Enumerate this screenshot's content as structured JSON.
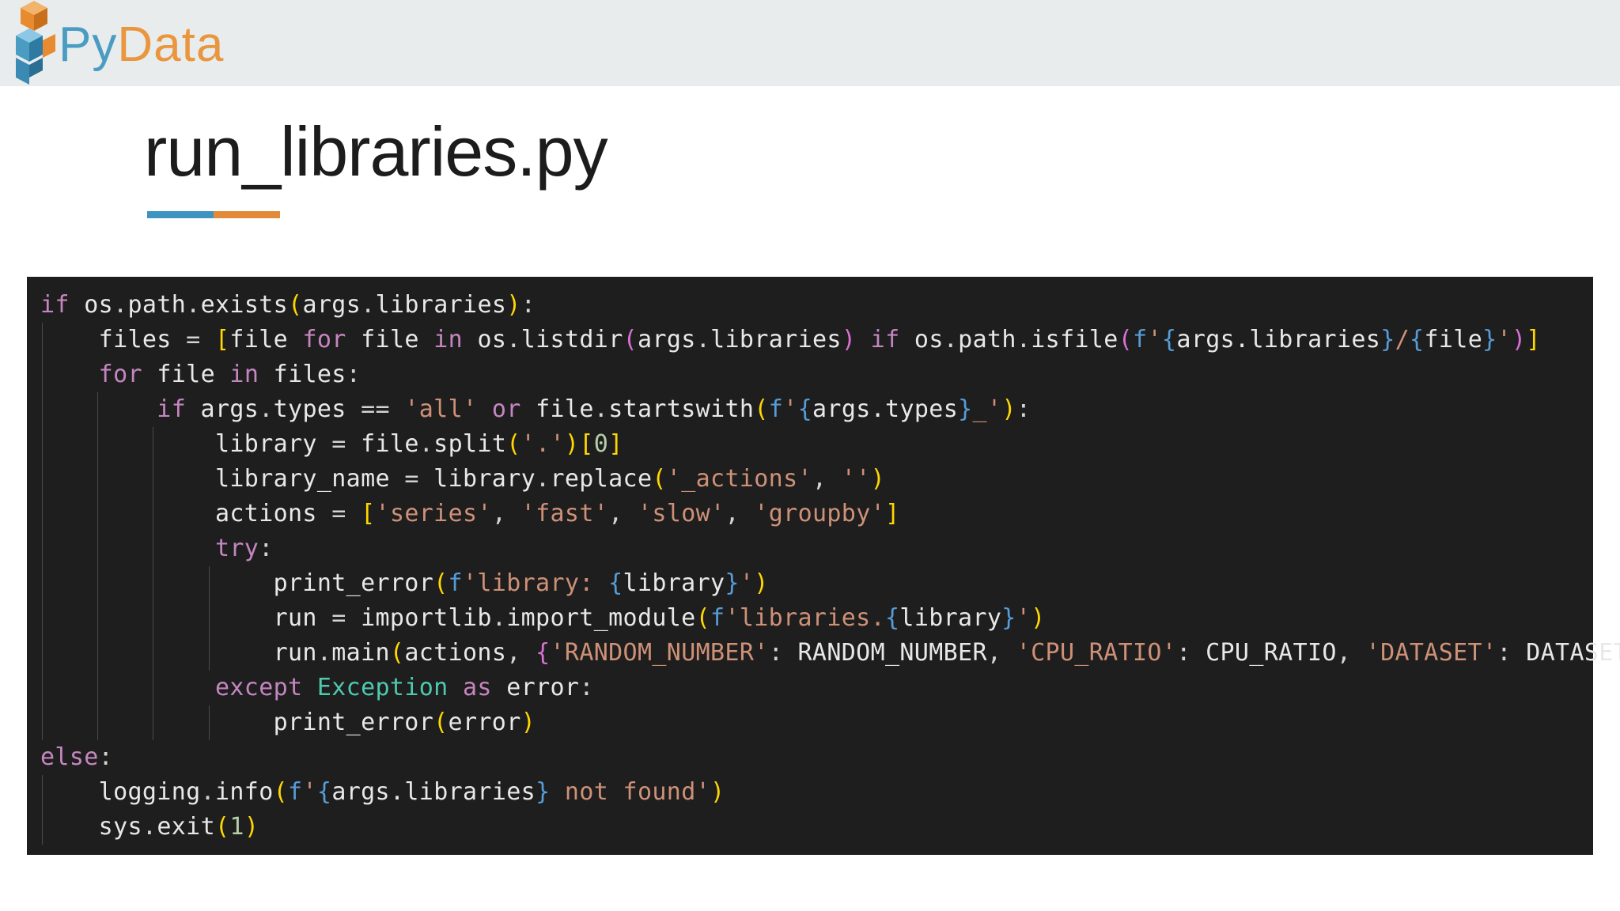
{
  "logo": {
    "py_text": "Py",
    "data_text": "Data",
    "colors": {
      "blue": "#4a9cc2",
      "orange": "#e9963f"
    },
    "icon": "pydata-cube-icon"
  },
  "slide": {
    "title": "run_libraries.py",
    "underline_colors": [
      "#3e94c0",
      "#e38a38"
    ]
  },
  "code": {
    "language": "python",
    "background": "#1e1e1e",
    "lines": [
      "if os.path.exists(args.libraries):",
      "    files = [file for file in os.listdir(args.libraries) if os.path.isfile(f'{args.libraries}/{file}')]",
      "    for file in files:",
      "        if args.types == 'all' or file.startswith(f'{args.types}_'):",
      "            library = file.split('.')[0]",
      "            library_name = library.replace('_actions', '')",
      "            actions = ['series', 'fast', 'slow', 'groupby']",
      "            try:",
      "                print_error(f'library: {library}')",
      "                run = importlib.import_module(f'libraries.{library}')",
      "                run.main(actions, {'RANDOM_NUMBER': RANDOM_NUMBER, 'CPU_RATIO': CPU_RATIO, 'DATASET': DATASET})",
      "            except Exception as error:",
      "                print_error(error)",
      "else:",
      "    logging.info(f'{args.libraries} not found')",
      "    sys.exit(1)"
    ]
  }
}
